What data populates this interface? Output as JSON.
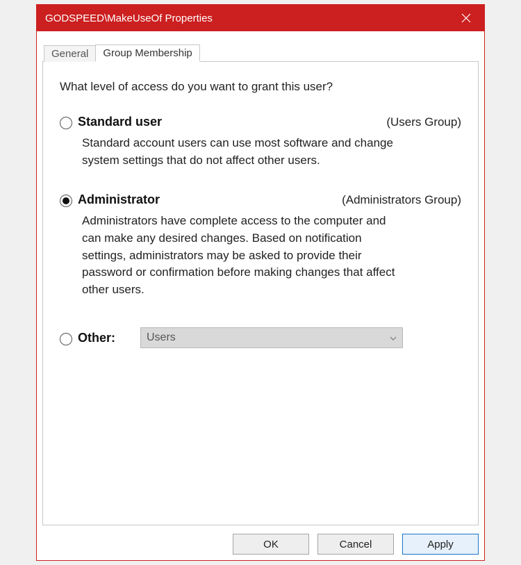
{
  "window": {
    "title": "GODSPEED\\MakeUseOf Properties"
  },
  "tabs": {
    "general": "General",
    "group_membership": "Group Membership"
  },
  "content": {
    "question": "What level of access do you want to grant this user?",
    "standard": {
      "label": "Standard user",
      "group": "(Users Group)",
      "desc": "Standard account users can use most software and change system settings that do not affect other users."
    },
    "admin": {
      "label": "Administrator",
      "group": "(Administrators Group)",
      "desc": "Administrators have complete access to the computer and can make any desired changes. Based on notification settings, administrators may be asked to provide their password or confirmation before making changes that affect other users."
    },
    "other": {
      "label": "Other:",
      "selected_value": "Users"
    }
  },
  "buttons": {
    "ok": "OK",
    "cancel": "Cancel",
    "apply": "Apply"
  }
}
